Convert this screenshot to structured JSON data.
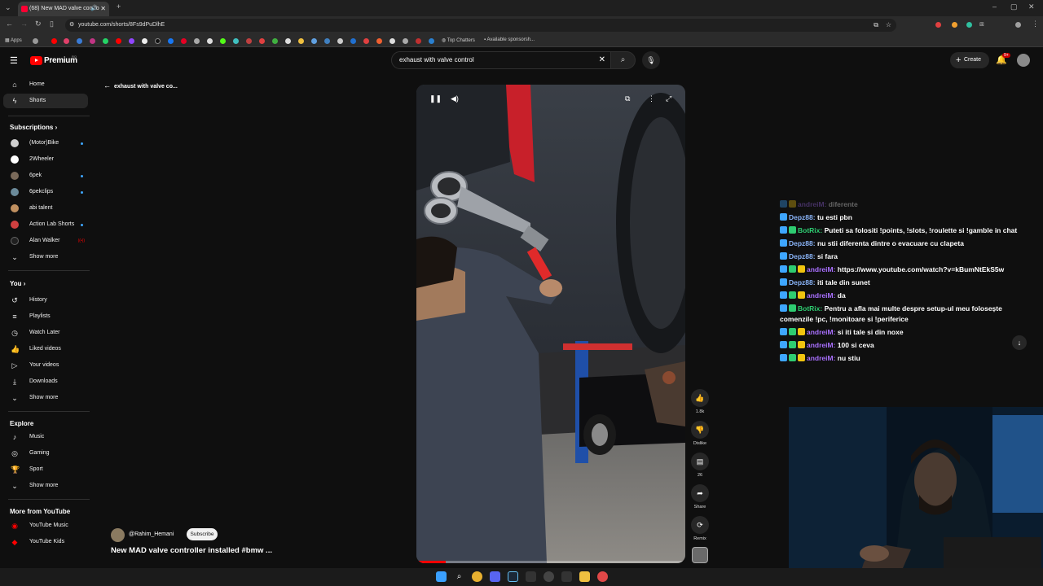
{
  "browser": {
    "tab_title": "(68) New MAD valve contro",
    "url": "youtube.com/shorts/8Fs9dPuDlhE",
    "bookmarks": {
      "apps": "Apps",
      "top_chatters": "Top Chatters",
      "available_sponsorsh": "Available sponsorsh..."
    }
  },
  "header": {
    "logo_text": "Premium",
    "logo_sup": "RO",
    "search_value": "exhaust with valve control",
    "create_label": "Create",
    "notif_count": "9+"
  },
  "sidebar": {
    "main": [
      {
        "label": "Home",
        "icon": "home-icon"
      },
      {
        "label": "Shorts",
        "icon": "shorts-icon"
      }
    ],
    "subscriptions_heading": "Subscriptions",
    "subscriptions": [
      {
        "label": "(Motor)Bike",
        "color": "#d0d0d0"
      },
      {
        "label": "2Wheeler",
        "color": "#ffffff"
      },
      {
        "label": "6pek",
        "color": "#7a6a5a"
      },
      {
        "label": "6pekclips",
        "color": "#6b8a9a"
      },
      {
        "label": "abi talent",
        "color": "#c09060"
      },
      {
        "label": "Action Lab Shorts",
        "color": "#d04040"
      },
      {
        "label": "Alan Walker",
        "color": "#202020"
      }
    ],
    "alan_walker_badge": "((•))",
    "show_more_1": "Show more",
    "you_heading": "You",
    "you": [
      {
        "label": "History",
        "icon": "history-icon"
      },
      {
        "label": "Playlists",
        "icon": "playlists-icon"
      },
      {
        "label": "Watch Later",
        "icon": "watch-later-icon"
      },
      {
        "label": "Liked videos",
        "icon": "liked-videos-icon"
      },
      {
        "label": "Your videos",
        "icon": "your-videos-icon"
      },
      {
        "label": "Downloads",
        "icon": "downloads-icon"
      }
    ],
    "show_more_2": "Show more",
    "explore_heading": "Explore",
    "explore": [
      {
        "label": "Music",
        "icon": "music-icon"
      },
      {
        "label": "Gaming",
        "icon": "gaming-icon"
      },
      {
        "label": "Sport",
        "icon": "sport-icon"
      }
    ],
    "show_more_3": "Show more",
    "more_heading": "More from YouTube",
    "more": [
      {
        "label": "YouTube Music",
        "icon": "youtube-music-icon"
      },
      {
        "label": "YouTube Kids",
        "icon": "youtube-kids-icon"
      }
    ]
  },
  "back_label": "exhaust with valve co...",
  "video": {
    "channel": "@Rahim_Hemani",
    "subscribe_label": "Subscribe",
    "title": "New MAD valve controller installed #bmw ...",
    "progress": 0.11
  },
  "actions": {
    "likes": "1.8k",
    "dislike": "Dislike",
    "comments": "26",
    "share": "Share",
    "remix": "Remix"
  },
  "chat": [
    {
      "user": "andreiM:",
      "text": "diferente",
      "class": "u-andrei",
      "badges": [
        "#3ea6ff",
        "#f1c40f"
      ],
      "faded": true
    },
    {
      "user": "Depz88:",
      "text": "tu esti pbn",
      "class": "u-depz",
      "badges": [
        "#3ea6ff"
      ]
    },
    {
      "user": "BotRix:",
      "text": "Puteti sa folositi !points, !slots, !roulette si !gamble in chat",
      "class": "u-bot",
      "badges": [
        "#3ea6ff",
        "#2ecc71"
      ]
    },
    {
      "user": "Depz88:",
      "text": "nu stii diferenta dintre o evacuare cu clapeta",
      "class": "u-depz",
      "badges": [
        "#3ea6ff"
      ]
    },
    {
      "user": "Depz88:",
      "text": "si fara",
      "class": "u-depz",
      "badges": [
        "#3ea6ff"
      ]
    },
    {
      "user": "andreiM:",
      "text": "https://www.youtube.com/watch?v=kBumNtEkS5w",
      "class": "u-andrei",
      "badges": [
        "#3ea6ff",
        "#2ecc71",
        "#f1c40f"
      ]
    },
    {
      "user": "Depz88:",
      "text": "iti tale din sunet",
      "class": "u-depz",
      "badges": [
        "#3ea6ff"
      ]
    },
    {
      "user": "andreiM:",
      "text": "da",
      "class": "u-andrei",
      "badges": [
        "#3ea6ff",
        "#2ecc71",
        "#f1c40f"
      ]
    },
    {
      "user": "BotRix:",
      "text": "Pentru a afla mai multe despre setup-ul meu folosește comenzile !pc, !monitoare si !periferice",
      "class": "u-bot",
      "badges": [
        "#3ea6ff",
        "#2ecc71"
      ]
    },
    {
      "user": "andreiM:",
      "text": "si iti tale si din noxe",
      "class": "u-andrei",
      "badges": [
        "#3ea6ff",
        "#2ecc71",
        "#f1c40f"
      ]
    },
    {
      "user": "andreiM:",
      "text": "100 si ceva",
      "class": "u-andrei",
      "badges": [
        "#3ea6ff",
        "#2ecc71",
        "#f1c40f"
      ]
    },
    {
      "user": "andreiM:",
      "text": "nu stiu",
      "class": "u-andrei",
      "badges": [
        "#3ea6ff",
        "#2ecc71",
        "#f1c40f"
      ]
    }
  ],
  "colors": {
    "youtube_red": "#ff0000",
    "bg": "#0f0f0f",
    "accent_blue": "#3ea6ff"
  }
}
